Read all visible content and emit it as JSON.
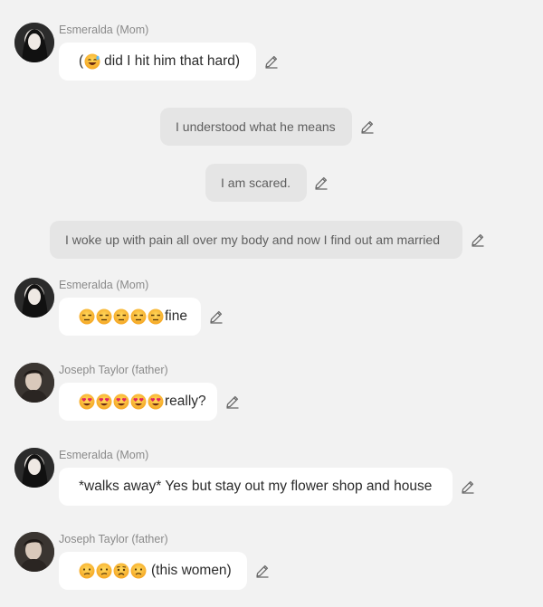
{
  "messages": [
    {
      "sender": "Esmeralda (Mom)",
      "text": "did I hit him that hard)",
      "prefix": "(",
      "emoji": [
        "laughing-sweat"
      ]
    },
    {
      "text": "I understood what he means"
    },
    {
      "text": "I am scared."
    },
    {
      "text": "I woke up with pain all over my body and now I find out am married"
    },
    {
      "sender": "Esmeralda (Mom)",
      "text": "fine",
      "emoji": [
        "unamused",
        "unamused",
        "unamused",
        "unamused",
        "unamused"
      ]
    },
    {
      "sender": "Joseph Taylor (father)",
      "text": "really?",
      "emoji": [
        "heart-eyes",
        "heart-eyes",
        "heart-eyes",
        "heart-eyes",
        "heart-eyes"
      ]
    },
    {
      "sender": "Esmeralda (Mom)",
      "text": "*walks away* Yes but stay out my flower shop and house"
    },
    {
      "sender": "Joseph Taylor (father)",
      "text": "(this women)",
      "emoji": [
        "confused",
        "confused",
        "worried",
        "frowning"
      ]
    }
  ],
  "icons": {
    "edit": "pencil-icon"
  },
  "colors": {
    "background": "#f2f2f2",
    "bubble_own": "#e5e5e5",
    "bubble_other": "#ffffff"
  }
}
